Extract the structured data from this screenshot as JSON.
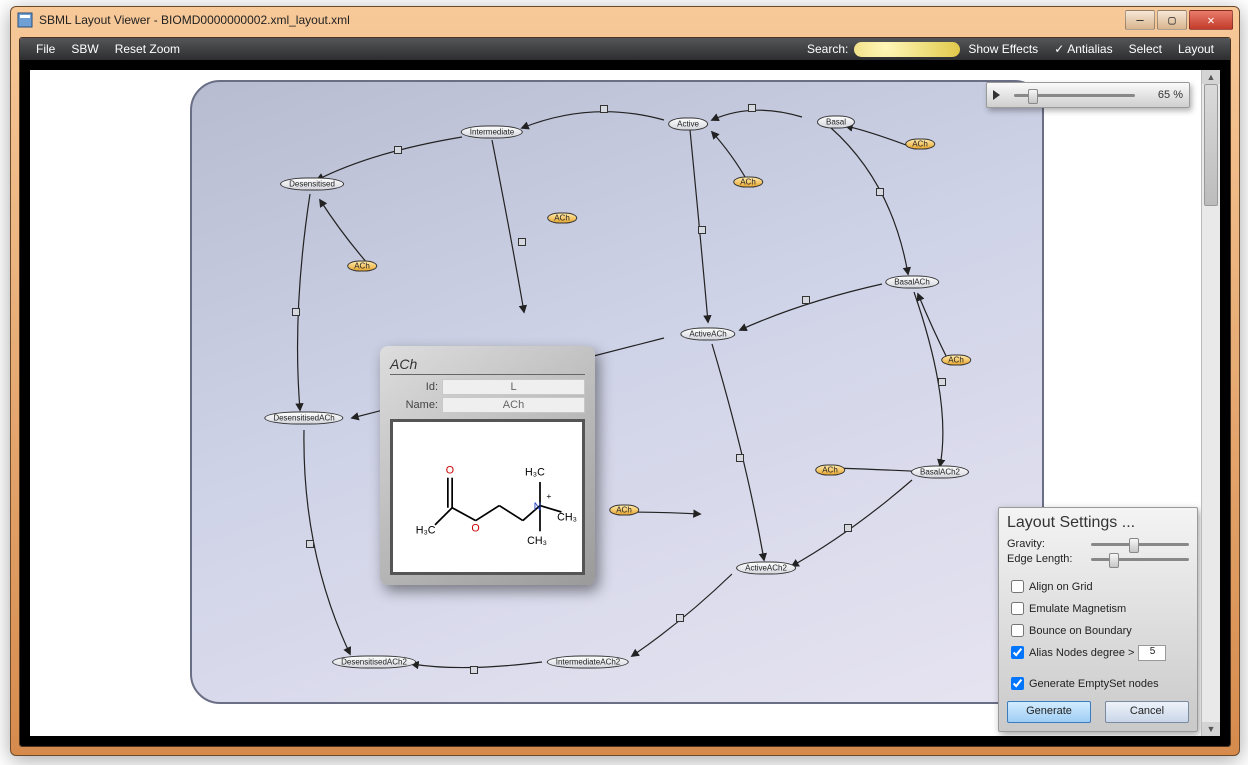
{
  "window": {
    "title": "SBML Layout Viewer - BIOMD0000000002.xml_layout.xml"
  },
  "menubar": {
    "file": "File",
    "sbw": "SBW",
    "reset_zoom": "Reset Zoom",
    "search_label": "Search:",
    "show_effects": "Show Effects",
    "antialias": "Antialias",
    "select": "Select",
    "layout": "Layout"
  },
  "zoom": {
    "pct": "65 %"
  },
  "tooltip": {
    "title": "ACh",
    "id_label": "Id:",
    "id_value": "L",
    "name_label": "Name:",
    "name_value": "ACh"
  },
  "settings": {
    "title": "Layout Settings ...",
    "gravity": "Gravity:",
    "edge_length": "Edge Length:",
    "align_grid": "Align on Grid",
    "emulate_mag": "Emulate Magnetism",
    "bounce": "Bounce on Boundary",
    "alias_nodes": "Alias Nodes degree >",
    "alias_value": "5",
    "gen_empty": "Generate EmptySet nodes",
    "generate": "Generate",
    "cancel": "Cancel"
  },
  "nodes": {
    "intermediate": "Intermediate",
    "active": "Active",
    "basal": "Basal",
    "desensitised": "Desensitised",
    "basal_ach": "BasalACh",
    "active_ach": "ActiveACh",
    "desensitised_ach": "DesensitisedACh",
    "basal_ach2": "BasalACh2",
    "active_ach2": "ActiveACh2",
    "desensitised_ach2": "DesensitisedACh2",
    "intermediate_ach2": "IntermediateACh2",
    "ach": "ACh"
  },
  "mol": {
    "o_dbl": "O",
    "o": "O",
    "n": "N",
    "ch3_a": "CH₃",
    "ch3_b": "H₃C",
    "ch3_c": "H₃C",
    "ch3_d": "CH₃",
    "plus": "+"
  }
}
